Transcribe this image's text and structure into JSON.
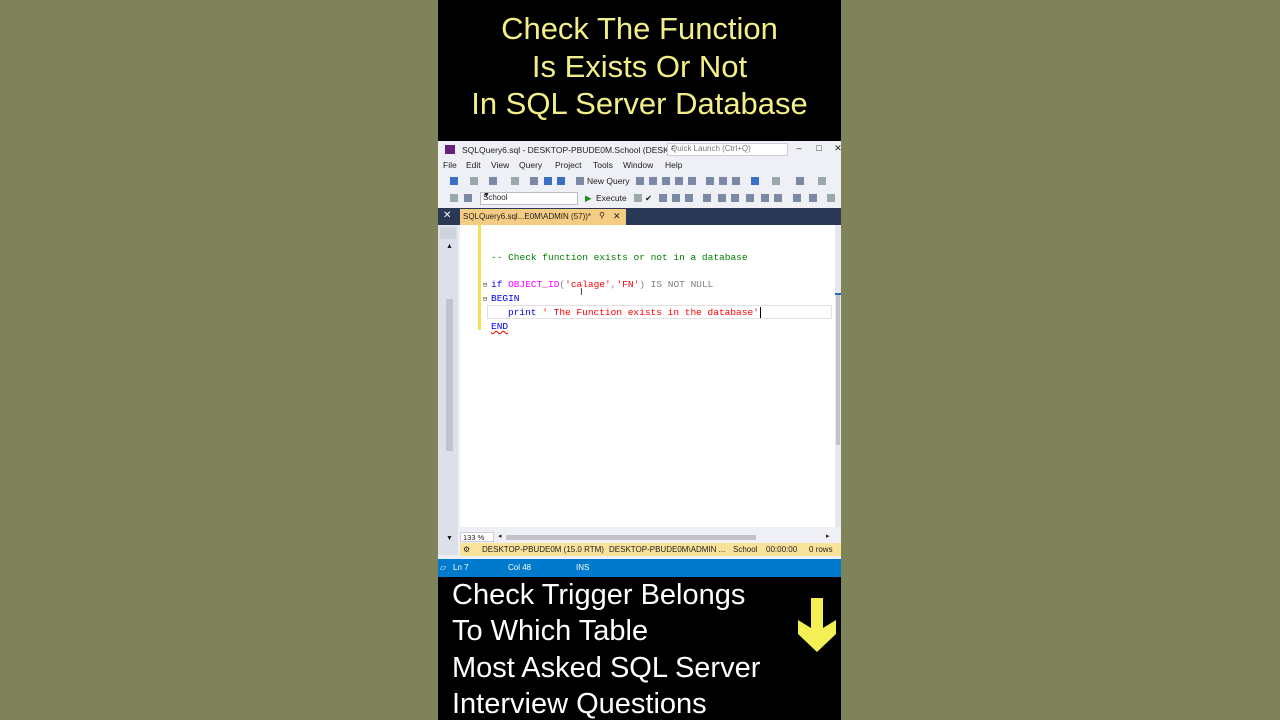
{
  "top_caption": [
    "Check The Function",
    "Is Exists Or Not",
    "In SQL Server Database"
  ],
  "bottom_caption": [
    "Check Trigger Belongs",
    "To Which Table",
    "Most Asked SQL Server",
    "Interview Questions"
  ],
  "window": {
    "title": "SQLQuery6.sql - DESKTOP-PBUDE0M.School (DESKT...",
    "quick_launch_placeholder": "Quick Launch (Ctrl+Q)"
  },
  "menu": [
    "File",
    "Edit",
    "View",
    "Query",
    "Project",
    "Tools",
    "Window",
    "Help"
  ],
  "toolbar": {
    "new_query": "New Query",
    "database": "School",
    "execute": "Execute"
  },
  "tab": {
    "label": "SQLQuery6.sql...E0M\\ADMIN (57))*"
  },
  "code": {
    "comment": "-- Check function exists or not in a database",
    "if_kw": "if",
    "object_id_fn": "OBJECT_ID",
    "paren_open": "(",
    "arg1": "'calage'",
    "comma": ",",
    "arg2": "'FN'",
    "paren_close": ")",
    "is_not_null": "IS NOT NULL",
    "begin": "BEGIN",
    "print_kw": "print",
    "print_str": "' The Function exists in the database'",
    "end": "END"
  },
  "zoom": "133 %",
  "query_status": {
    "server": "DESKTOP-PBUDE0M (15.0 RTM)",
    "user": "DESKTOP-PBUDE0M\\ADMIN ...",
    "database": "School",
    "elapsed": "00:00:00",
    "rows": "0 rows"
  },
  "status_bar": {
    "ln": "Ln 7",
    "col": "Col 48",
    "mode": "INS"
  },
  "colors": {
    "background": "#808359",
    "caption_yellow": "#f3ef88",
    "status_blue": "#007acc",
    "tab_yellow": "#f5cc84",
    "query_status_yellow": "#f9e39b"
  }
}
